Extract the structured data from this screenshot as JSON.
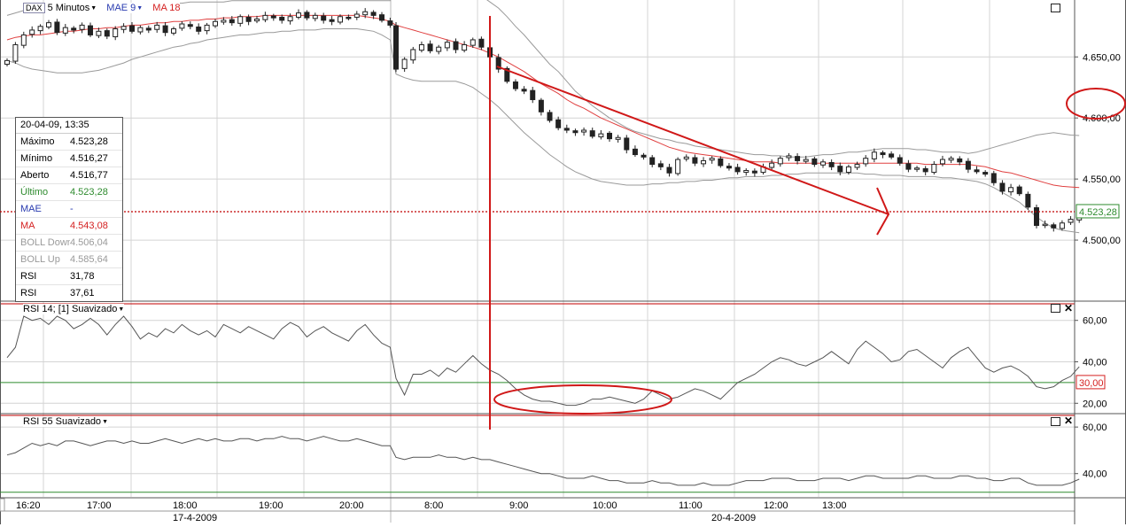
{
  "header": {
    "instrument": "DAX",
    "interval": "5 Minutos",
    "indicator_mae": "MAE 9",
    "indicator_ma": "MA 18"
  },
  "info_box": {
    "datetime": "20-04-09, 13:35",
    "rows": [
      {
        "label": "Máximo",
        "value": "4.523,28",
        "color": "#000000"
      },
      {
        "label": "Mínimo",
        "value": "4.516,27",
        "color": "#000000"
      },
      {
        "label": "Aberto",
        "value": "4.516,77",
        "color": "#000000"
      },
      {
        "label": "Último",
        "value": "4.523,28",
        "color": "#2e8b2e"
      },
      {
        "label": "MAE",
        "value": "-",
        "color": "#2a3cb0"
      },
      {
        "label": "MA",
        "value": "4.543,08",
        "color": "#d42020"
      },
      {
        "label": "BOLL Down",
        "value": "4.506,04",
        "color": "#9a9a9a"
      },
      {
        "label": "BOLL Up",
        "value": "4.585,64",
        "color": "#9a9a9a"
      },
      {
        "label": "RSI",
        "value": "31,78",
        "color": "#000000"
      },
      {
        "label": "RSI",
        "value": "37,61",
        "color": "#000000"
      }
    ]
  },
  "panels": {
    "rsi14_title": "RSI 14; [1] Suavizado",
    "rsi55_title": "RSI 55 Suavizado"
  },
  "chart_data": {
    "type": "candlestick",
    "instrument": "DAX",
    "interval": "5 Minutos",
    "price_axis": {
      "ticks": [
        "4.500,00",
        "4.550,00",
        "4.600,00",
        "4.650,00"
      ],
      "ylim": [
        4450,
        4685
      ]
    },
    "last_price_label": "4.523,28",
    "time_labels": [
      "16:20",
      "17:00",
      "18:00",
      "19:00",
      "20:00",
      "8:00",
      "9:00",
      "10:00",
      "11:00",
      "12:00",
      "13:00"
    ],
    "date_labels": [
      "17-4-2009",
      "20-4-2009"
    ],
    "rsi14_axis": {
      "ticks": [
        "20,00",
        "40,00",
        "60,00"
      ],
      "ylim": [
        15,
        68
      ]
    },
    "rsi14_level_label": "30,00",
    "rsi55_axis": {
      "ticks": [
        "40,00",
        "60,00"
      ],
      "ylim": [
        30,
        65
      ]
    },
    "close": [
      4647,
      4660,
      4668,
      4672,
      4675,
      4678,
      4670,
      4674,
      4672,
      4676,
      4668,
      4671,
      4667,
      4673,
      4675,
      4671,
      4674,
      4672,
      4676,
      4670,
      4673,
      4677,
      4675,
      4671,
      4676,
      4679,
      4680,
      4678,
      4683,
      4679,
      4681,
      4684,
      4682,
      4680,
      4683,
      4686,
      4682,
      4684,
      4680,
      4679,
      4683,
      4682,
      4685,
      4687,
      4684,
      4680,
      4676,
      4640,
      4648,
      4656,
      4660,
      4655,
      4658,
      4662,
      4656,
      4660,
      4664,
      4658,
      4650,
      4640,
      4630,
      4624,
      4622,
      4615,
      4605,
      4598,
      4592,
      4590,
      4588,
      4590,
      4585,
      4587,
      4583,
      4584,
      4574,
      4570,
      4568,
      4562,
      4560,
      4555,
      4566,
      4568,
      4563,
      4565,
      4567,
      4561,
      4559,
      4556,
      4557,
      4555,
      4560,
      4563,
      4567,
      4569,
      4565,
      4566,
      4562,
      4564,
      4560,
      4556,
      4560,
      4562,
      4567,
      4572,
      4570,
      4568,
      4563,
      4558,
      4559,
      4556,
      4562,
      4566,
      4567,
      4564,
      4558,
      4556,
      4554,
      4547,
      4540,
      4543,
      4538,
      4527,
      4512,
      4513,
      4510,
      4514,
      4517,
      4523.28
    ],
    "ma": [
      4664,
      4666,
      4667,
      4668,
      4668,
      4669,
      4670,
      4671,
      4671,
      4672,
      4673,
      4673,
      4674,
      4674,
      4675,
      4676,
      4676,
      4677,
      4678,
      4678,
      4679,
      4679,
      4680,
      4680,
      4681,
      4681,
      4682,
      4682,
      4683,
      4683,
      4683,
      4684,
      4684,
      4684,
      4684,
      4684,
      4684,
      4684,
      4684,
      4684,
      4684,
      4684,
      4684,
      4683,
      4682,
      4681,
      4679,
      4676,
      4674,
      4672,
      4670,
      4668,
      4666,
      4664,
      4662,
      4660,
      4658,
      4656,
      4653,
      4650,
      4646,
      4642,
      4638,
      4633,
      4628,
      4624,
      4620,
      4615,
      4611,
      4608,
      4604,
      4600,
      4597,
      4594,
      4591,
      4588,
      4585,
      4582,
      4579,
      4576,
      4574,
      4572,
      4571,
      4570,
      4569,
      4568,
      4567,
      4566,
      4565,
      4564,
      4564,
      4564,
      4563,
      4563,
      4563,
      4563,
      4563,
      4563,
      4563,
      4563,
      4563,
      4563,
      4563,
      4563,
      4563,
      4563,
      4563,
      4563,
      4563,
      4562,
      4562,
      4562,
      4562,
      4562,
      4562,
      4561,
      4560,
      4558,
      4556,
      4555,
      4553,
      4551,
      4549,
      4547,
      4545,
      4544,
      4543.5,
      4543.08
    ],
    "boll_up": [
      4684,
      4686,
      4688,
      4689,
      4690,
      4690,
      4691,
      4691,
      4691,
      4692,
      4692,
      4692,
      4692,
      4692,
      4692,
      4693,
      4693,
      4693,
      4694,
      4694,
      4694,
      4694,
      4695,
      4695,
      4695,
      4695,
      4695,
      4696,
      4696,
      4696,
      4696,
      4696,
      4696,
      4696,
      4696,
      4696,
      4696,
      4696,
      4696,
      4696,
      4696,
      4696,
      4696,
      4696,
      4696,
      4696,
      4696,
      4708,
      4712,
      4713,
      4713,
      4713,
      4713,
      4712,
      4711,
      4708,
      4704,
      4700,
      4695,
      4690,
      4683,
      4675,
      4668,
      4660,
      4652,
      4644,
      4638,
      4630,
      4622,
      4616,
      4610,
      4605,
      4600,
      4596,
      4592,
      4589,
      4587,
      4585,
      4583,
      4582,
      4580,
      4579,
      4577,
      4576,
      4575,
      4574,
      4573,
      4572,
      4571,
      4570,
      4570,
      4569,
      4569,
      4568,
      4568,
      4568,
      4569,
      4570,
      4570,
      4571,
      4572,
      4572,
      4573,
      4574,
      4575,
      4575,
      4575,
      4575,
      4574,
      4574,
      4573,
      4572,
      4572,
      4572,
      4571,
      4572,
      4574,
      4576,
      4578,
      4580,
      4582,
      4584,
      4586,
      4587,
      4588,
      4587,
      4586,
      4585.64
    ],
    "boll_down": [
      4647,
      4645,
      4642,
      4640,
      4639,
      4638,
      4637,
      4637,
      4637,
      4637,
      4638,
      4639,
      4641,
      4643,
      4645,
      4648,
      4650,
      4652,
      4654,
      4656,
      4658,
      4659,
      4661,
      4662,
      4664,
      4665,
      4666,
      4667,
      4668,
      4668,
      4669,
      4670,
      4670,
      4671,
      4671,
      4672,
      4672,
      4672,
      4673,
      4673,
      4673,
      4673,
      4673,
      4672,
      4671,
      4668,
      4664,
      4636,
      4633,
      4631,
      4630,
      4630,
      4630,
      4630,
      4630,
      4628,
      4625,
      4620,
      4615,
      4609,
      4602,
      4595,
      4588,
      4582,
      4576,
      4570,
      4565,
      4560,
      4556,
      4553,
      4550,
      4548,
      4547,
      4546,
      4545,
      4545,
      4545,
      4546,
      4546,
      4547,
      4547,
      4548,
      4548,
      4549,
      4549,
      4550,
      4551,
      4551,
      4552,
      4552,
      4552,
      4553,
      4553,
      4554,
      4554,
      4555,
      4555,
      4555,
      4555,
      4555,
      4555,
      4555,
      4554,
      4554,
      4553,
      4553,
      4553,
      4552,
      4552,
      4552,
      4552,
      4551,
      4551,
      4550,
      4549,
      4548,
      4546,
      4543,
      4539,
      4535,
      4531,
      4525,
      4519,
      4514,
      4510,
      4508,
      4507,
      4506.04
    ],
    "rsi14": [
      42,
      47,
      62,
      60,
      61,
      58,
      62,
      60,
      56,
      58,
      61,
      58,
      53,
      58,
      62,
      57,
      51,
      54,
      52,
      56,
      54,
      58,
      55,
      53,
      55,
      52,
      58,
      56,
      54,
      57,
      55,
      53,
      51,
      56,
      59,
      57,
      52,
      55,
      57,
      54,
      52,
      50,
      55,
      58,
      53,
      49,
      47,
      32,
      24,
      34,
      34,
      36,
      33,
      37,
      35,
      39,
      43,
      39,
      36,
      34,
      31,
      27,
      24,
      22,
      21,
      21,
      20,
      19,
      19,
      20,
      22,
      22,
      23,
      22,
      21,
      20,
      22,
      26,
      24,
      22,
      23,
      25,
      27,
      26,
      24,
      22,
      26,
      30,
      32,
      34,
      37,
      40,
      42,
      41,
      39,
      38,
      40,
      42,
      45,
      42,
      39,
      46,
      50,
      47,
      44,
      40,
      41,
      45,
      46,
      43,
      40,
      37,
      42,
      45,
      47,
      42,
      37,
      35,
      37,
      38,
      36,
      33,
      28,
      27,
      28,
      31,
      33,
      37.61
    ],
    "rsi55": [
      48,
      49,
      51,
      53,
      52,
      53,
      52,
      54,
      54,
      53,
      52,
      53,
      54,
      54,
      53,
      54,
      53,
      53,
      54,
      55,
      54,
      53,
      54,
      55,
      54,
      55,
      54,
      54,
      55,
      55,
      54,
      55,
      55,
      56,
      55,
      55,
      54,
      55,
      56,
      55,
      54,
      54,
      55,
      54,
      53,
      52,
      52,
      47,
      46,
      47,
      47,
      47,
      48,
      47,
      47,
      46,
      47,
      46,
      46,
      45,
      44,
      43,
      42,
      41,
      40,
      40,
      39,
      38,
      38,
      38,
      39,
      38,
      37,
      37,
      36,
      36,
      36,
      37,
      36,
      36,
      35,
      35,
      35,
      36,
      35,
      35,
      35,
      36,
      37,
      37,
      37,
      38,
      38,
      38,
      37,
      37,
      37,
      38,
      38,
      38,
      37,
      38,
      39,
      39,
      38,
      38,
      38,
      38,
      39,
      39,
      38,
      38,
      38,
      39,
      39,
      38,
      38,
      37,
      37,
      38,
      38,
      36,
      35,
      35,
      35,
      35,
      36,
      37.61
    ],
    "levels": {
      "rsi14_oversold": 30,
      "price_last": 4523.28
    },
    "annotations": [
      "vertical line",
      "descending trend line",
      "ellipse around 4.600,00",
      "ellipse around RSI lows",
      "arrow at last price"
    ]
  },
  "colors": {
    "candle_up": "#ffffff",
    "candle_down": "#222222",
    "ma_line": "#e04040",
    "boll_line": "#9a9a9a",
    "rsi_line": "#555555",
    "level_line": "#2e8b2e",
    "last_price": "#c00000",
    "annotation": "#d01818",
    "grid": "#d4d4d4",
    "panel_border": "#c00000"
  }
}
